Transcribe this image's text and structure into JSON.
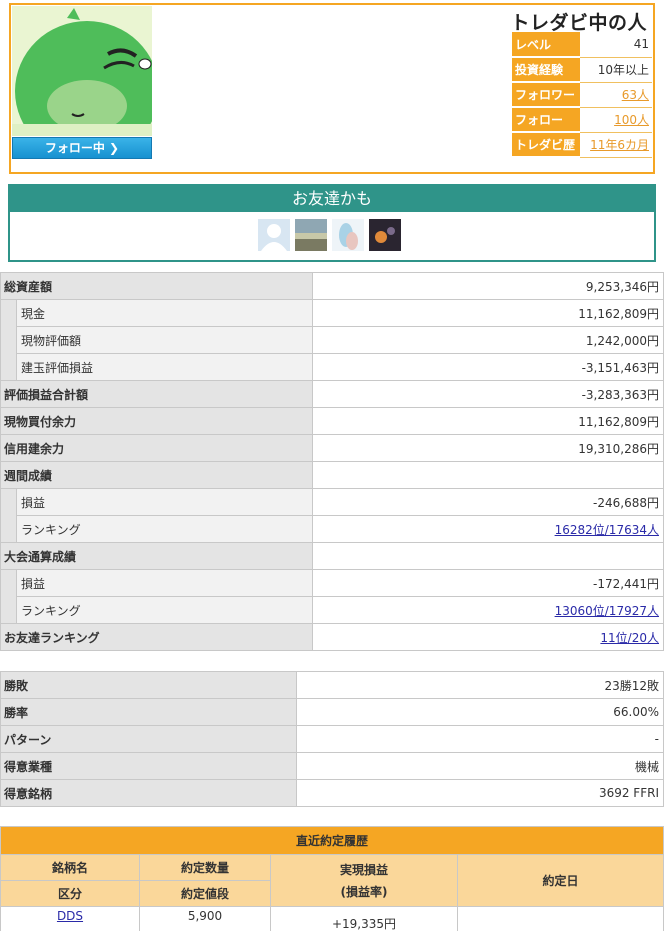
{
  "profile": {
    "name": "トレダビ中の人",
    "follow_button": "フォロー中 ❯",
    "stats": [
      {
        "label": "レベル",
        "value": "41",
        "link": false
      },
      {
        "label": "投資経験",
        "value": "10年以上",
        "link": false
      },
      {
        "label": "フォロワー",
        "value": "63人",
        "link": true
      },
      {
        "label": "フォロー",
        "value": "100人",
        "link": true
      },
      {
        "label": "トレダビ歴",
        "value": "11年6カ月",
        "link": true
      }
    ]
  },
  "friends": {
    "title": "お友達かも"
  },
  "assets": {
    "total_label": "総資産額",
    "total_value": "9,253,346円",
    "cash_label": "現金",
    "cash_value": "11,162,809円",
    "spot_label": "現物評価額",
    "spot_value": "1,242,000円",
    "margin_pl_label": "建玉評価損益",
    "margin_pl_value": "-3,151,463円",
    "unrealized_label": "評価損益合計額",
    "unrealized_value": "-3,283,363円",
    "spot_power_label": "現物買付余力",
    "spot_power_value": "11,162,809円",
    "margin_power_label": "信用建余力",
    "margin_power_value": "19,310,286円",
    "weekly_label": "週間成績",
    "weekly_pl_label": "損益",
    "weekly_pl_value": "-246,688円",
    "weekly_rank_label": "ランキング",
    "weekly_rank_value": "16282位/17634人",
    "contest_label": "大会通算成績",
    "contest_pl_label": "損益",
    "contest_pl_value": "-172,441円",
    "contest_rank_label": "ランキング",
    "contest_rank_value": "13060位/17927人",
    "friend_rank_label": "お友達ランキング",
    "friend_rank_value": "11位/20人"
  },
  "record": {
    "winloss_label": "勝敗",
    "winloss_value": "23勝12敗",
    "winrate_label": "勝率",
    "winrate_value": "66.00%",
    "pattern_label": "パターン",
    "pattern_value": "-",
    "sector_label": "得意業種",
    "sector_value": "機械",
    "stock_label": "得意銘柄",
    "stock_value": "3692 FFRI"
  },
  "trades": {
    "title": "直近約定履歴",
    "col_name": "銘柄名",
    "col_qty": "約定数量",
    "col_pl": "実現損益",
    "col_pl_rate": "(損益率)",
    "col_date": "約定日",
    "col_type": "区分",
    "col_price": "約定値段",
    "row1_name": "DDS",
    "row1_qty": "5,900",
    "row1_pl": "+19,335円"
  },
  "colors": {
    "accent_orange": "#f5a623",
    "teal": "#2f9489",
    "follow_blue": "#1791d0"
  }
}
